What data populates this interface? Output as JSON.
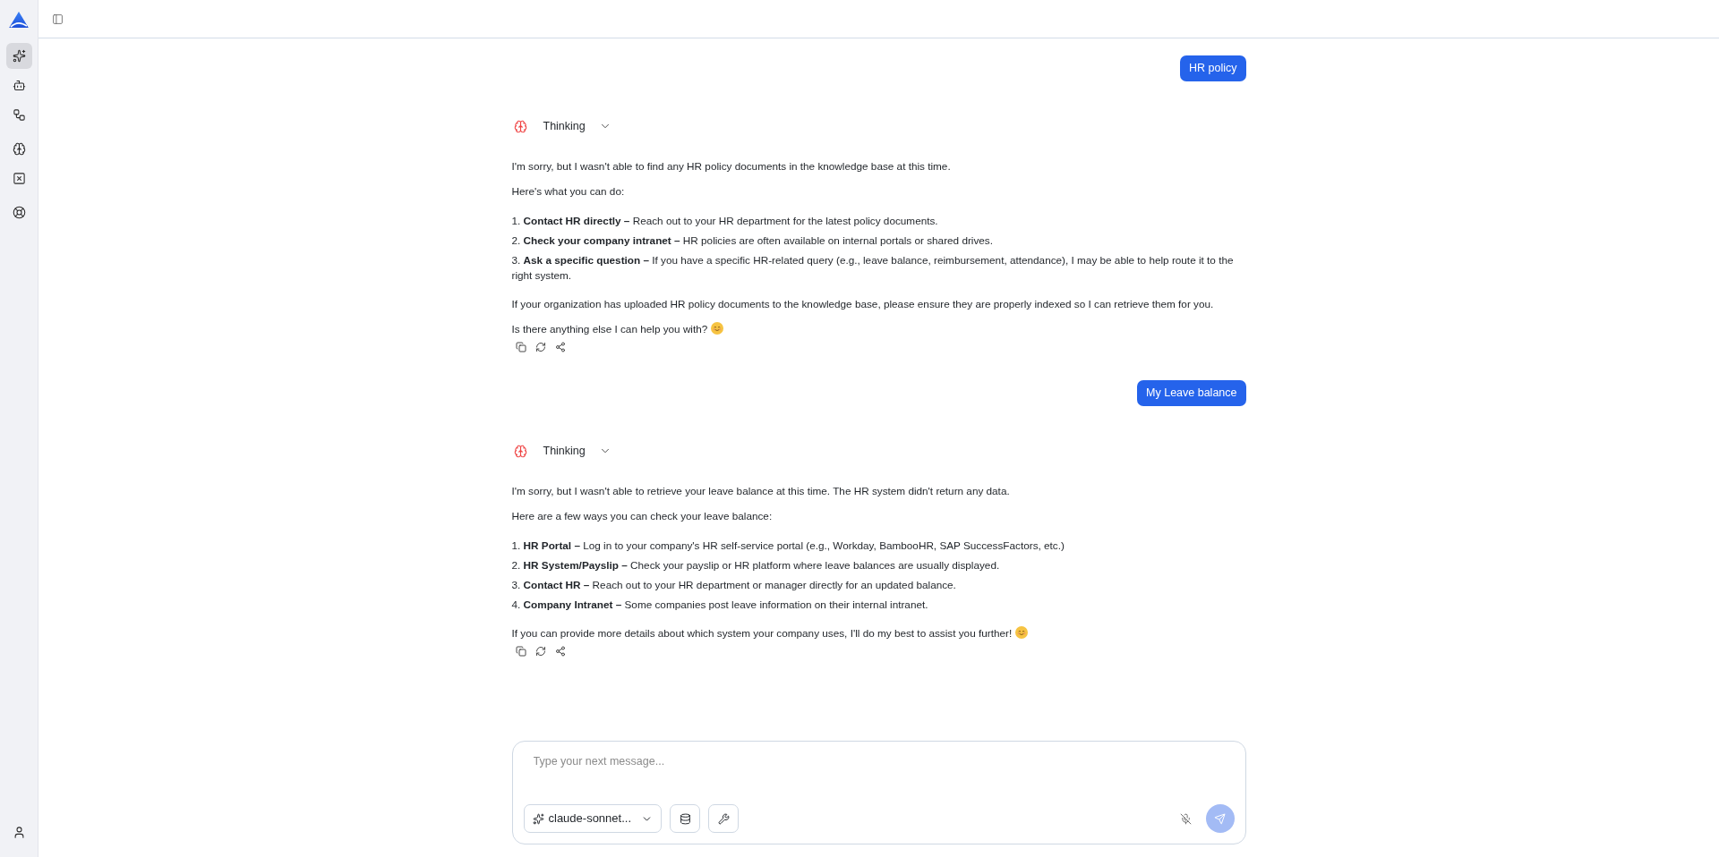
{
  "sidebar": {
    "groups": [
      {
        "items": [
          {
            "selected": true
          },
          {
            "selected": false
          },
          {
            "selected": false
          }
        ]
      },
      {
        "items": [
          {
            "selected": false
          },
          {
            "selected": false
          }
        ]
      },
      {
        "items": [
          {
            "selected": false
          }
        ]
      }
    ]
  },
  "messages": [
    {
      "kind": "user",
      "text": "HR policy"
    },
    {
      "kind": "assistant",
      "thinking": {
        "label": "Thinking",
        "expanded": false
      },
      "blocks": [
        {
          "kind": "paragraph",
          "text": "I'm sorry, but I wasn't able to find any HR policy documents in the knowledge base at this time."
        },
        {
          "kind": "paragraph",
          "text": "Here's what you can do:"
        },
        {
          "kind": "list",
          "items": [
            "1. **Contact HR directly –** Reach out to your HR department for the latest policy documents.",
            "2. **Check your company intranet –** HR policies are often available on internal portals or shared drives.",
            "3. **Ask a specific question –** If you have a specific HR-related query (e.g., leave balance, reimbursement, attendance), I may be able to help route it to the right system."
          ]
        },
        {
          "kind": "paragraph",
          "text": "If your organization has uploaded HR policy documents to the knowledge base, please ensure they are properly indexed so I can retrieve them for you."
        },
        {
          "kind": "paragraph_emoji",
          "text": "Is there anything else I can help you with?"
        }
      ]
    },
    {
      "kind": "user",
      "text": "My Leave balance"
    },
    {
      "kind": "assistant",
      "thinking": {
        "label": "Thinking",
        "expanded": false
      },
      "blocks": [
        {
          "kind": "paragraph",
          "text": "I'm sorry, but I wasn't able to retrieve your leave balance at this time. The HR system didn't return any data."
        },
        {
          "kind": "paragraph",
          "text": "Here are a few ways you can check your leave balance:"
        },
        {
          "kind": "list",
          "items": [
            "1. **HR Portal –** Log in to your company's HR self-service portal (e.g., Workday, BambooHR, SAP SuccessFactors, etc.)",
            "2. **HR System/Payslip –** Check your payslip or HR platform where leave balances are usually displayed.",
            "3. **Contact HR –** Reach out to your HR department or manager directly for an updated balance.",
            "4. **Company Intranet –** Some companies post leave information on their internal intranet."
          ]
        },
        {
          "kind": "paragraph_emoji",
          "text": "If you can provide more details about which system your company uses, I'll do my best to assist you further!"
        }
      ]
    }
  ],
  "composer": {
    "placeholder": "Type your next message...",
    "model": "claude-sonnet...",
    "send": {
      "disabled": true
    }
  }
}
